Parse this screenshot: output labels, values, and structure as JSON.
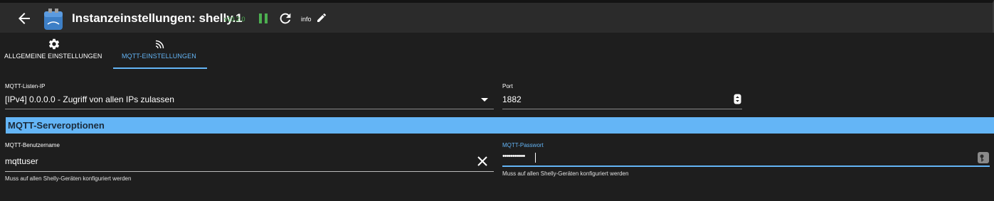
{
  "header": {
    "title": "Instanzeinstellungen: shelly.1",
    "version": "v10.2.0",
    "info_label": "info",
    "back_icon": "arrow-left-icon",
    "logo_icon": "shelly-adapter-logo",
    "pause_icon": "pause-icon",
    "restart_icon": "restart-icon",
    "edit_icon": "pencil-icon",
    "colors": {
      "background": "#2b2b2b",
      "version": "#4caf50",
      "pause": "#4caf50"
    }
  },
  "tabs": [
    {
      "label": "ALLGEMEINE EINSTELLUNGEN",
      "icon": "gear-icon",
      "active": false
    },
    {
      "label": "MQTT-EINSTELLUNGEN",
      "icon": "wifi-signal-icon",
      "active": true
    }
  ],
  "form": {
    "listen_ip": {
      "label": "MQTT-Listen-IP",
      "value": "[IPv4] 0.0.0.0 - Zugriff von allen IPs zulassen"
    },
    "port": {
      "label": "Port",
      "value": "1882"
    },
    "section": {
      "title": "MQTT-Serveroptionen",
      "color": "#64b5f6"
    },
    "username": {
      "label": "MQTT-Benutzername",
      "value": "mqttuser",
      "helper": "Muss auf allen Shelly-Geräten konfiguriert werden"
    },
    "password": {
      "label": "MQTT-Passwort",
      "value": "•••••••••••",
      "helper": "Muss auf allen Shelly-Geräten konfiguriert werden",
      "focused_color": "#64b5f6"
    }
  }
}
